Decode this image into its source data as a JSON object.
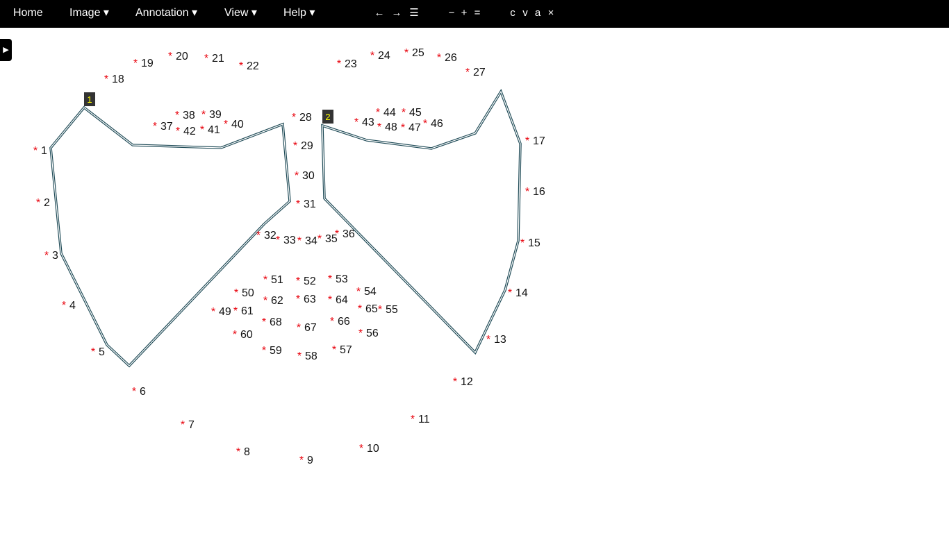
{
  "menu": {
    "home": "Home",
    "image": "Image ▾",
    "annotation": "Annotation ▾",
    "view": "View ▾",
    "help": "Help ▾"
  },
  "toolbar": {
    "prev": "←",
    "next": "→",
    "list": "☰",
    "zoom_out": "−",
    "zoom_in": "+",
    "zoom_reset": "=",
    "copy": "c",
    "paste": "v",
    "select_all": "a",
    "delete": "×"
  },
  "side_toggle": "▶",
  "colors": {
    "point": "#e8000b",
    "polygon": "#1e4a56",
    "region_label_bg": "#333333",
    "region_label_text": "#ffff00"
  },
  "regions": [
    {
      "id": "1"
    },
    {
      "id": "2"
    }
  ],
  "landmarks": [
    "1",
    "2",
    "3",
    "4",
    "5",
    "6",
    "7",
    "8",
    "9",
    "10",
    "11",
    "12",
    "13",
    "14",
    "15",
    "16",
    "17",
    "18",
    "19",
    "20",
    "21",
    "22",
    "23",
    "24",
    "25",
    "26",
    "27",
    "28",
    "29",
    "30",
    "31",
    "32",
    "33",
    "34",
    "35",
    "36",
    "37",
    "38",
    "39",
    "40",
    "41",
    "42",
    "43",
    "44",
    "45",
    "46",
    "47",
    "48",
    "49",
    "50",
    "51",
    "52",
    "53",
    "54",
    "55",
    "56",
    "57",
    "58",
    "59",
    "60",
    "61",
    "62",
    "63",
    "64",
    "65",
    "66",
    "67",
    "68"
  ]
}
